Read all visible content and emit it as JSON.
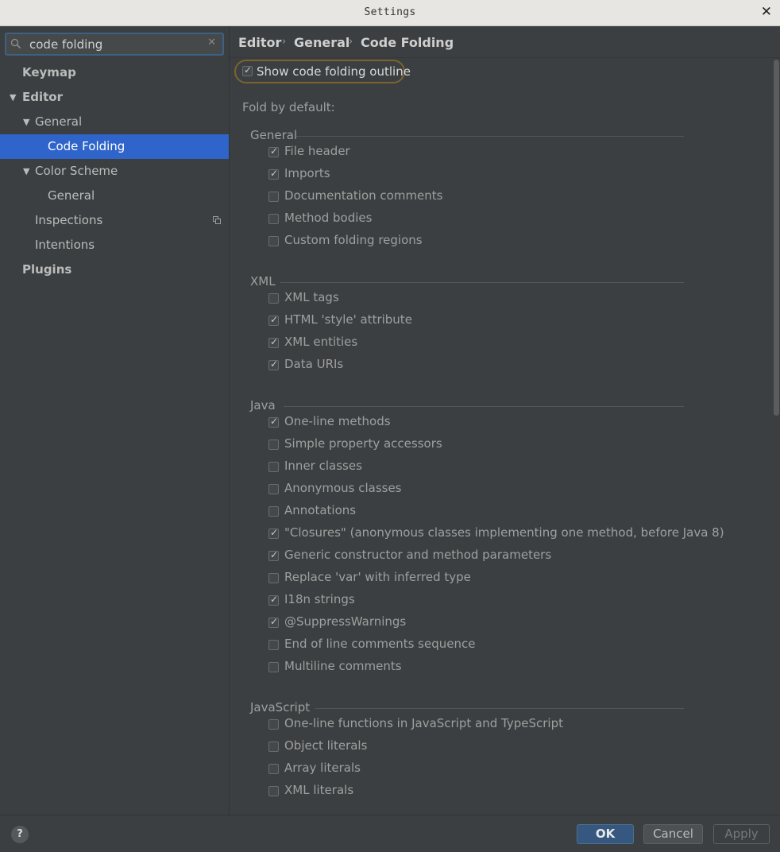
{
  "window": {
    "title": "Settings"
  },
  "search": {
    "value": "code folding"
  },
  "tree": {
    "keymap": "Keymap",
    "editor": "Editor",
    "general": "General",
    "code_folding": "Code Folding",
    "color_scheme": "Color Scheme",
    "color_scheme_general": "General",
    "inspections": "Inspections",
    "intentions": "Intentions",
    "plugins": "Plugins"
  },
  "breadcrumb": [
    "Editor",
    "General",
    "Code Folding"
  ],
  "show_outline": {
    "label": "Show code folding outline",
    "checked": true
  },
  "fold_by_default_label": "Fold by default:",
  "sections": [
    {
      "title": "General",
      "options": [
        {
          "label": "File header",
          "checked": true
        },
        {
          "label": "Imports",
          "checked": true
        },
        {
          "label": "Documentation comments",
          "checked": false
        },
        {
          "label": "Method bodies",
          "checked": false
        },
        {
          "label": "Custom folding regions",
          "checked": false
        }
      ]
    },
    {
      "title": "XML",
      "options": [
        {
          "label": "XML tags",
          "checked": false
        },
        {
          "label": "HTML 'style' attribute",
          "checked": true
        },
        {
          "label": "XML entities",
          "checked": true
        },
        {
          "label": "Data URIs",
          "checked": true
        }
      ]
    },
    {
      "title": "Java",
      "options": [
        {
          "label": "One-line methods",
          "checked": true
        },
        {
          "label": "Simple property accessors",
          "checked": false
        },
        {
          "label": "Inner classes",
          "checked": false
        },
        {
          "label": "Anonymous classes",
          "checked": false
        },
        {
          "label": "Annotations",
          "checked": false
        },
        {
          "label": "\"Closures\" (anonymous classes implementing one method, before Java 8)",
          "checked": true
        },
        {
          "label": "Generic constructor and method parameters",
          "checked": true
        },
        {
          "label": "Replace 'var' with inferred type",
          "checked": false
        },
        {
          "label": "I18n strings",
          "checked": true
        },
        {
          "label": "@SuppressWarnings",
          "checked": true
        },
        {
          "label": "End of line comments sequence",
          "checked": false
        },
        {
          "label": "Multiline comments",
          "checked": false
        }
      ]
    },
    {
      "title": "JavaScript",
      "options": [
        {
          "label": "One-line functions in JavaScript and TypeScript",
          "checked": false
        },
        {
          "label": "Object literals",
          "checked": false
        },
        {
          "label": "Array literals",
          "checked": false
        },
        {
          "label": "XML literals",
          "checked": false
        }
      ]
    }
  ],
  "footer": {
    "help": "?",
    "ok": "OK",
    "cancel": "Cancel",
    "apply": "Apply"
  }
}
